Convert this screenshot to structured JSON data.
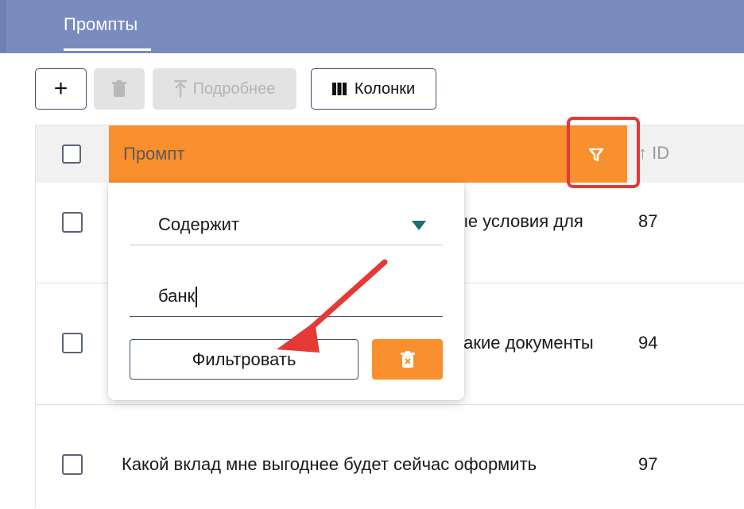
{
  "header": {
    "tab_label": "Промпты"
  },
  "toolbar": {
    "add_label": "+",
    "details_label": "Подробнее",
    "columns_label": "Колонки"
  },
  "table": {
    "columns": {
      "prompt": "Промпт",
      "id": "ID",
      "id_sort_icon": "arrow-up-icon"
    },
    "rows": [
      {
        "text": "ые условия для",
        "id": "87"
      },
      {
        "text": "какие документы",
        "id": "94"
      },
      {
        "text": "Какой вклад мне выгоднее будет сейчас оформить",
        "id": "97"
      }
    ]
  },
  "filter_popup": {
    "operator": "Содержит",
    "value": "банк",
    "apply_label": "Фильтровать",
    "clear_icon": "trash-x-icon"
  },
  "colors": {
    "header_bar": "#7a8bbd",
    "accent_orange": "#fa8f2d",
    "highlight_red": "#e53935",
    "caret_teal": "#1a7070"
  }
}
